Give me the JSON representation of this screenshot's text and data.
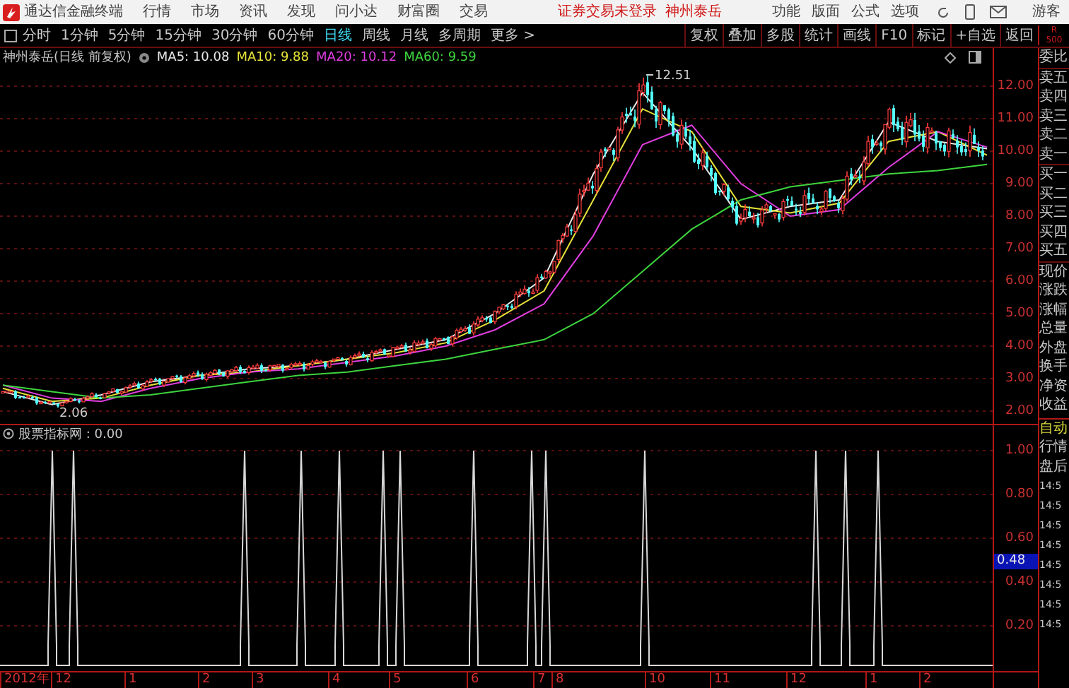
{
  "title_bar": {
    "app_name": "通达信金融终端",
    "menus": [
      "行情",
      "市场",
      "资讯",
      "发现",
      "问小达",
      "财富圈",
      "交易"
    ],
    "status": "证券交易未登录",
    "stock": "神州泰岳",
    "tools": [
      "功能",
      "版面",
      "公式",
      "选项"
    ],
    "user": "游客"
  },
  "period_tabs": [
    {
      "label": "分时",
      "selected": false
    },
    {
      "label": "1分钟",
      "selected": false
    },
    {
      "label": "5分钟",
      "selected": false
    },
    {
      "label": "15分钟",
      "selected": false
    },
    {
      "label": "30分钟",
      "selected": false
    },
    {
      "label": "60分钟",
      "selected": false
    },
    {
      "label": "日线",
      "selected": true
    },
    {
      "label": "周线",
      "selected": false
    },
    {
      "label": "月线",
      "selected": false
    },
    {
      "label": "多周期",
      "selected": false
    },
    {
      "label": "更多 >",
      "selected": false
    }
  ],
  "tool_buttons": [
    "复权",
    "叠加",
    "多股",
    "统计",
    "画线",
    "F10",
    "标记",
    "+自选",
    "返回"
  ],
  "legend": {
    "stock": "神州泰岳(日线 前复权)",
    "ma_values": [
      "10.08",
      "9.88",
      "10.12",
      "9.59"
    ]
  },
  "price_chart": {
    "high_label": "12.51",
    "low_label": "2.06",
    "chart_data": {
      "type": "line",
      "grid": true,
      "ylim": [
        2,
        12
      ],
      "yticks": [
        {
          "value": 12,
          "label": "12.00"
        },
        {
          "value": 11,
          "label": "11.00"
        },
        {
          "value": 10,
          "label": "10.00"
        },
        {
          "value": 9,
          "label": "9.00"
        },
        {
          "value": 8,
          "label": "8.00"
        },
        {
          "value": 7,
          "label": "7.00"
        },
        {
          "value": 6,
          "label": "6.00"
        },
        {
          "value": 5,
          "label": "5.00"
        },
        {
          "value": 4,
          "label": "4.00"
        },
        {
          "value": 3,
          "label": "3.00"
        },
        {
          "value": 2,
          "label": "2.00"
        }
      ],
      "series": [
        {
          "name": "MA5:",
          "color": "#e8e8e8",
          "values": [
            2.6,
            2.2,
            2.5,
            2.9,
            3.1,
            3.3,
            3.4,
            3.6,
            3.9,
            4.2,
            5.0,
            6.1,
            9.3,
            11.8,
            10.1,
            7.9,
            8.3,
            8.5,
            10.9,
            10.3,
            10.08
          ]
        },
        {
          "name": "MA10:",
          "color": "#e6e23a",
          "values": [
            2.7,
            2.3,
            2.4,
            2.8,
            3.1,
            3.2,
            3.4,
            3.6,
            3.8,
            4.1,
            4.8,
            5.7,
            8.5,
            11.3,
            10.6,
            8.3,
            8.1,
            8.4,
            10.3,
            10.6,
            9.88
          ]
        },
        {
          "name": "MA20:",
          "color": "#e03ee0",
          "values": [
            2.8,
            2.4,
            2.3,
            2.7,
            3.0,
            3.2,
            3.3,
            3.5,
            3.7,
            4.0,
            4.5,
            5.3,
            7.4,
            10.2,
            10.8,
            9.0,
            8.0,
            8.2,
            9.5,
            10.6,
            10.12
          ]
        },
        {
          "name": "MA60:",
          "color": "#3ed43e",
          "values": [
            2.8,
            2.6,
            2.4,
            2.5,
            2.7,
            2.9,
            3.1,
            3.2,
            3.4,
            3.6,
            3.9,
            4.2,
            5.0,
            6.3,
            7.6,
            8.5,
            8.9,
            9.1,
            9.3,
            9.4,
            9.59
          ]
        }
      ]
    }
  },
  "indicator": {
    "title": "股票指标网 : 0.00",
    "axis": [
      "1.00",
      "0.80",
      "0.60",
      "0.40",
      "0.20"
    ],
    "cursor_value": "0.48"
  },
  "x_axis": [
    "2012年",
    "12",
    "1",
    "2",
    "3",
    "4",
    "5",
    "6",
    "7",
    "8",
    "10",
    "11",
    "12",
    "1",
    "2"
  ],
  "side_panel": {
    "header": [
      "R",
      "500"
    ],
    "quote_labels": [
      "委比",
      "卖五",
      "卖四",
      "卖三",
      "卖二",
      "卖一",
      "买一",
      "买二",
      "买三",
      "买四",
      "买五",
      "现价",
      "涨跌",
      "涨幅",
      "总量",
      "外盘",
      "换手",
      "净资",
      "收益"
    ],
    "mode": "自动",
    "items": [
      "行情",
      "盘后"
    ],
    "times": [
      "14:5",
      "14:5",
      "14:5",
      "14:5",
      "14:5",
      "14:5",
      "14:5",
      "14:5"
    ]
  }
}
